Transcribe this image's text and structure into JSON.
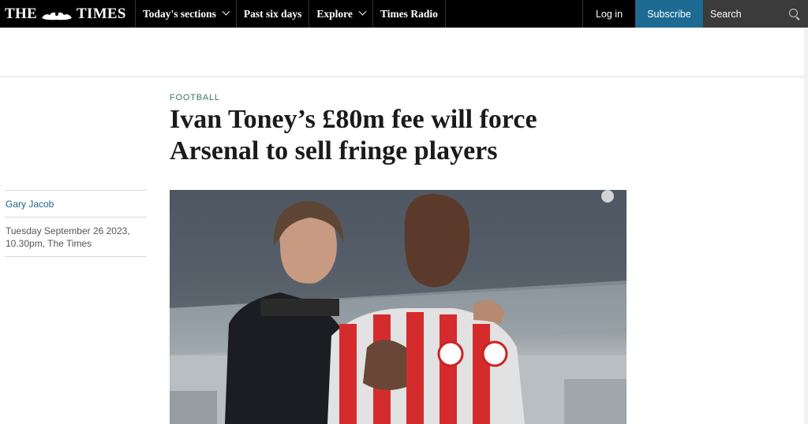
{
  "nav": {
    "logo_left": "THE",
    "logo_right": "TIMES",
    "items": [
      {
        "label": "Today's sections",
        "dropdown": true
      },
      {
        "label": "Past six days",
        "dropdown": false
      },
      {
        "label": "Explore",
        "dropdown": true
      },
      {
        "label": "Times Radio",
        "dropdown": false
      }
    ],
    "login_label": "Log in",
    "subscribe_label": "Subscribe",
    "search_label": "Search"
  },
  "article": {
    "section": "FOOTBALL",
    "headline": "Ivan Toney’s £80m fee will force Arsenal to sell fringe players",
    "author": "Gary Jacob",
    "dateline": "Tuesday September 26 2023, 10.30pm, The Times"
  },
  "colors": {
    "subscribe": "#1d6a93",
    "section_label": "#3a7a5b",
    "author_link": "#1d5f8a"
  }
}
